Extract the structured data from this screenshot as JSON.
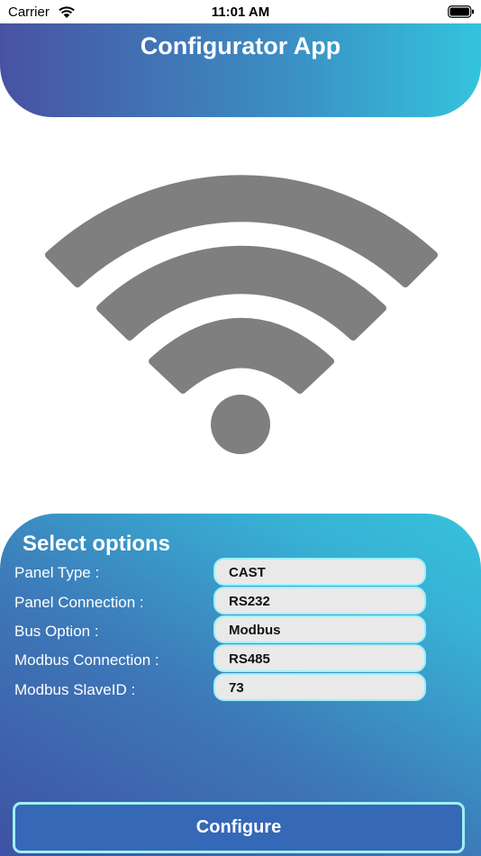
{
  "status_bar": {
    "carrier": "Carrier",
    "time": "11:01 AM"
  },
  "header": {
    "title": "Configurator App"
  },
  "hero": {
    "icon": "wifi-icon",
    "color": "#7f7f7f"
  },
  "options": {
    "title": "Select options",
    "rows": [
      {
        "label": "Panel Type :",
        "value": "CAST"
      },
      {
        "label": "Panel Connection :",
        "value": "RS232"
      },
      {
        "label": "Bus Option :",
        "value": "Modbus"
      },
      {
        "label": "Modbus Connection :",
        "value": "RS485"
      },
      {
        "label": "Modbus SlaveID :",
        "value": "73"
      }
    ]
  },
  "actions": {
    "configure_label": "Configure"
  },
  "colors": {
    "gradient_start": "#4852a3",
    "gradient_end": "#33c4dc",
    "field_border": "#9ff0f6",
    "button": "#3568b6"
  }
}
